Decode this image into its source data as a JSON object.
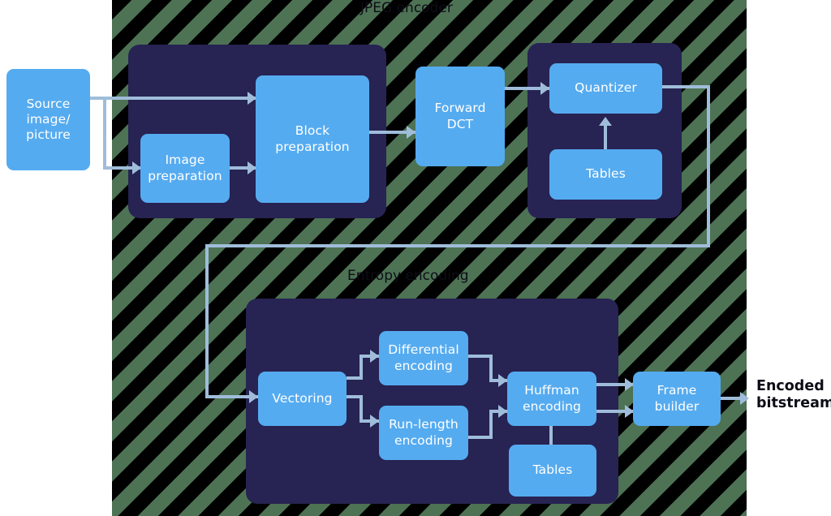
{
  "diagram": {
    "title": "JPEG encoder",
    "section_title": "Entropy encoding",
    "input_label": "Source image/\npicture",
    "output_label": "Encoded\nbitstream",
    "colors": {
      "node_fill": "#55ABF0",
      "panel_fill": "#272353",
      "wire": "#9FBDDA",
      "hatch_green": "#4d7254",
      "hatch_black": "#000000",
      "text_on_node": "#ffffff",
      "caption_text": "#0d0d17"
    },
    "nodes": {
      "image_preparation": "Image\npreparation",
      "block_preparation": "Block\npreparation",
      "forward_dct": "Forward\nDCT",
      "quantizer": "Quantizer",
      "quantizer_tables": "Tables",
      "vectoring": "Vectoring",
      "differential_encoding": "Differential\nencoding",
      "run_length_encoding": "Run-length\nencoding",
      "huffman_encoding": "Huffman\nencoding",
      "huffman_tables": "Tables",
      "frame_builder": "Frame\nbuilder"
    }
  }
}
